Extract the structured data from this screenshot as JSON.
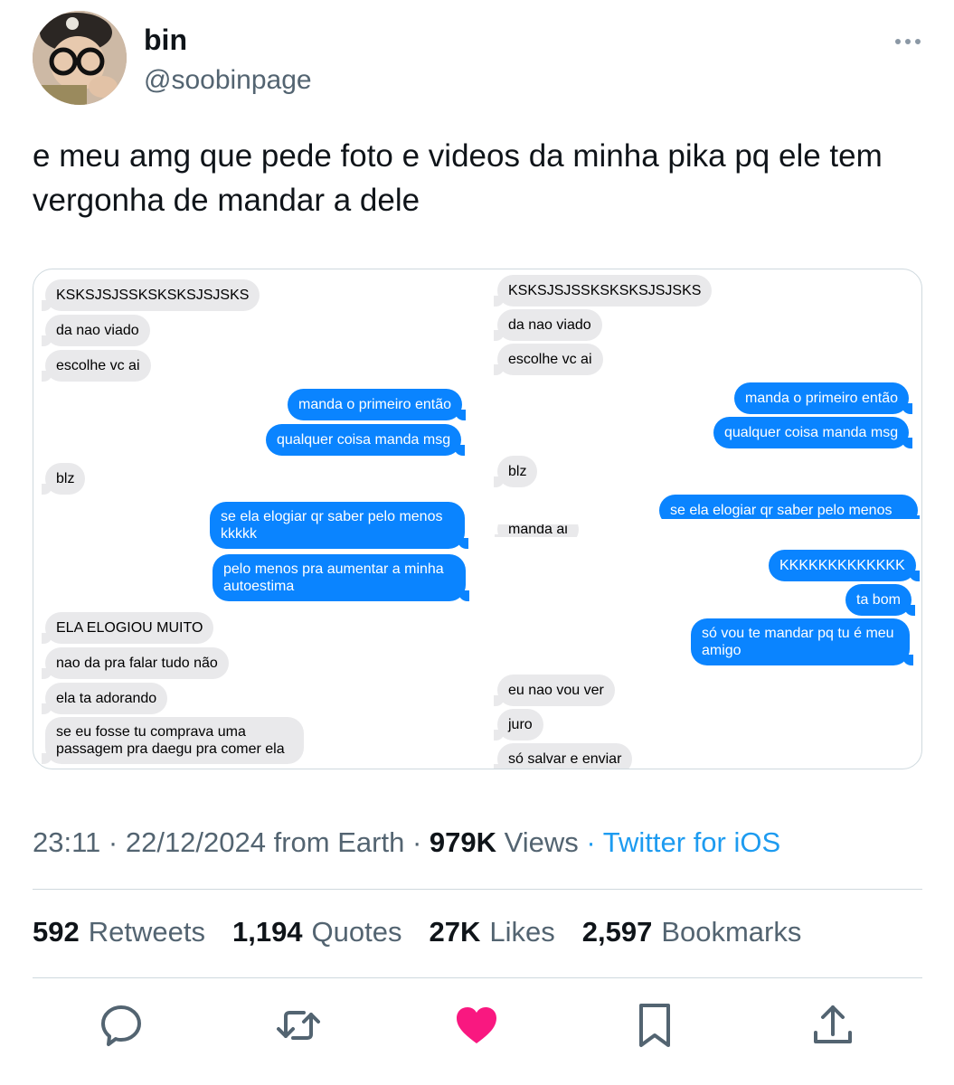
{
  "author": {
    "name": "bin",
    "handle": "@soobinpage"
  },
  "tweet": {
    "text": "e meu amg que pede foto e videos da minha pika pq ele tem vergonha de mandar a dele"
  },
  "media": {
    "left_chat": [
      {
        "dir": "in",
        "text": "KSKSJSJSSKSKSKSJSJSKS"
      },
      {
        "dir": "in",
        "text": "da nao viado"
      },
      {
        "dir": "in",
        "text": "escolhe vc ai"
      },
      {
        "dir": "out",
        "text": "manda o primeiro então"
      },
      {
        "dir": "out",
        "text": "qualquer coisa manda msg"
      },
      {
        "dir": "in",
        "text": "blz"
      },
      {
        "dir": "out",
        "text": "se ela elogiar qr saber pelo menos kkkkk"
      },
      {
        "dir": "out",
        "text": "pelo menos pra aumentar a minha autoestima"
      },
      {
        "dir": "in",
        "text": "ELA ELOGIOU MUITO"
      },
      {
        "dir": "in",
        "text": "nao da pra falar tudo não"
      },
      {
        "dir": "in",
        "text": "ela ta adorando"
      },
      {
        "dir": "in",
        "text": "se eu fosse tu comprava uma passagem pra daegu pra comer ela"
      }
    ],
    "right_chat": [
      {
        "dir": "in",
        "text": "KSKSJSJSSKSKSKSJSJSKS"
      },
      {
        "dir": "in",
        "text": "da nao viado"
      },
      {
        "dir": "in",
        "text": "escolhe vc ai"
      },
      {
        "dir": "out",
        "text": "manda o primeiro então"
      },
      {
        "dir": "out",
        "text": "qualquer coisa manda msg"
      },
      {
        "dir": "in",
        "text": "blz"
      },
      {
        "dir": "out",
        "text": "se ela elogiar qr saber pelo menos"
      },
      {
        "dir": "in",
        "text": "manda ai"
      },
      {
        "dir": "out",
        "text": "KKKKKKKKKKKKK"
      },
      {
        "dir": "out",
        "text": "ta bom"
      },
      {
        "dir": "out",
        "text": "só vou te mandar pq tu é meu amigo"
      },
      {
        "dir": "in",
        "text": "eu nao vou ver"
      },
      {
        "dir": "in",
        "text": "juro"
      },
      {
        "dir": "in",
        "text": "só salvar e enviar"
      }
    ]
  },
  "meta": {
    "time": "23:11",
    "date": "22/12/2024",
    "location": "from Earth",
    "views_count": "979K",
    "views_label": "Views",
    "source": "Twitter for iOS"
  },
  "stats": {
    "retweets_count": "592",
    "retweets_label": "Retweets",
    "quotes_count": "1,194",
    "quotes_label": "Quotes",
    "likes_count": "27K",
    "likes_label": "Likes",
    "bookmarks_count": "2,597",
    "bookmarks_label": "Bookmarks"
  },
  "actions": {
    "reply_icon": "reply-icon",
    "retweet_icon": "retweet-icon",
    "like_icon": "heart-icon",
    "like_color": "#f91880",
    "bookmark_icon": "bookmark-icon",
    "share_icon": "share-icon",
    "icon_color": "#536471"
  }
}
